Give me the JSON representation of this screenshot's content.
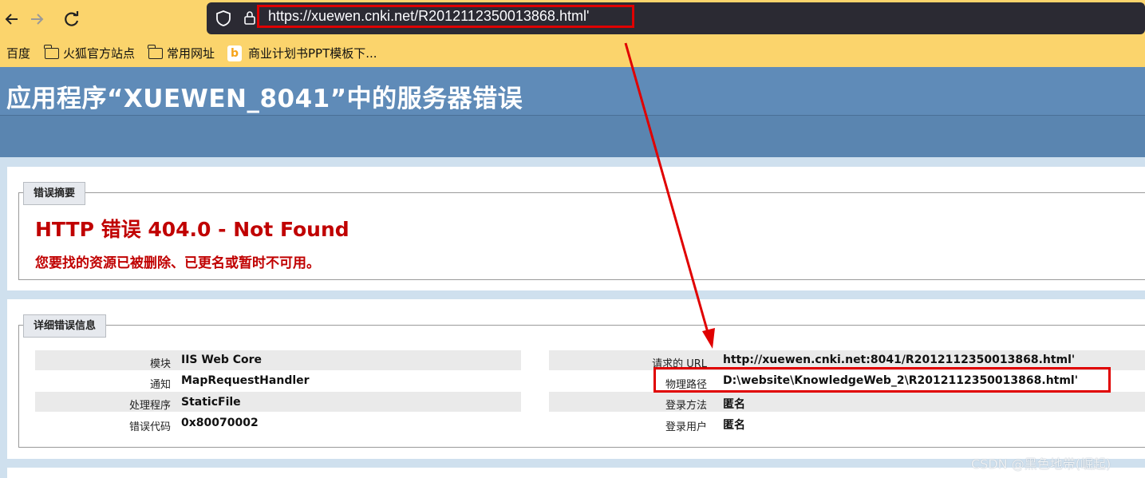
{
  "browser": {
    "back_icon": "arrow-left-icon",
    "forward_icon": "arrow-right-icon",
    "reload_icon": "reload-icon",
    "url": "https://xuewen.cnki.net/R2012112350013868.html'",
    "colors": {
      "toolbar": "#fbd46c",
      "urlbar": "#2b2a33",
      "annotation": "#e00000"
    }
  },
  "bookmarks": [
    {
      "label": "百度",
      "icon": "baidu-icon"
    },
    {
      "label": "火狐官方站点",
      "icon": "folder-icon"
    },
    {
      "label": "常用网址",
      "icon": "folder-icon"
    },
    {
      "label": "商业计划书PPT模板下...",
      "icon": "bing-icon"
    }
  ],
  "page": {
    "title": "应用程序“XUEWEN_8041”中的服务器错误",
    "summary": {
      "legend": "错误摘要",
      "error_title": "HTTP 错误 404.0 - Not Found",
      "error_message": "您要找的资源已被删除、已更名或暂时不可用。"
    },
    "details": {
      "legend": "详细错误信息",
      "left": [
        {
          "label": "模块",
          "value": "IIS Web Core"
        },
        {
          "label": "通知",
          "value": "MapRequestHandler"
        },
        {
          "label": "处理程序",
          "value": "StaticFile"
        },
        {
          "label": "错误代码",
          "value": "0x80070002"
        }
      ],
      "right": [
        {
          "label": "请求的 URL",
          "value": "http://xuewen.cnki.net:8041/R2012112350013868.html'"
        },
        {
          "label": "物理路径",
          "value": "D:\\website\\KnowledgeWeb_2\\R2012112350013868.html'"
        },
        {
          "label": "登录方法",
          "value": "匿名"
        },
        {
          "label": "登录用户",
          "value": "匿名"
        }
      ]
    }
  },
  "watermark": "CSDN @黑色地带(崛起)"
}
